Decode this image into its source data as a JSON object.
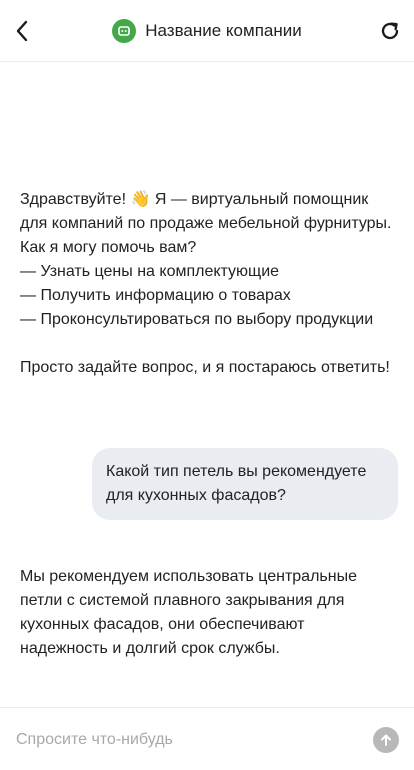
{
  "header": {
    "title": "Название компании",
    "back_icon": "chevron-left-icon",
    "logo_icon": "bot-icon",
    "refresh_icon": "refresh-icon",
    "logo_color": "#44a84a"
  },
  "messages": [
    {
      "role": "bot",
      "text": "Здравствуйте! 👋 Я — виртуальный помощник для компаний по продаже мебельной фурнитуры. Как я могу помочь вам?\n— Узнать цены на комплектующие\n— Получить информацию о товарах\n— Проконсультироваться по выбору продукции\n\nПросто задайте вопрос, и я постараюсь ответить!"
    },
    {
      "role": "user",
      "text": "Какой тип петель вы рекомендуете для кухонных фасадов?"
    },
    {
      "role": "bot",
      "text": "Мы рекомендуем использовать центральные петли с системой плавного закрывания для кухонных фасадов, они обеспечивают надежность и долгий срок службы."
    }
  ],
  "composer": {
    "placeholder": "Спросите что-нибудь",
    "value": "",
    "send_icon": "arrow-up-icon"
  }
}
